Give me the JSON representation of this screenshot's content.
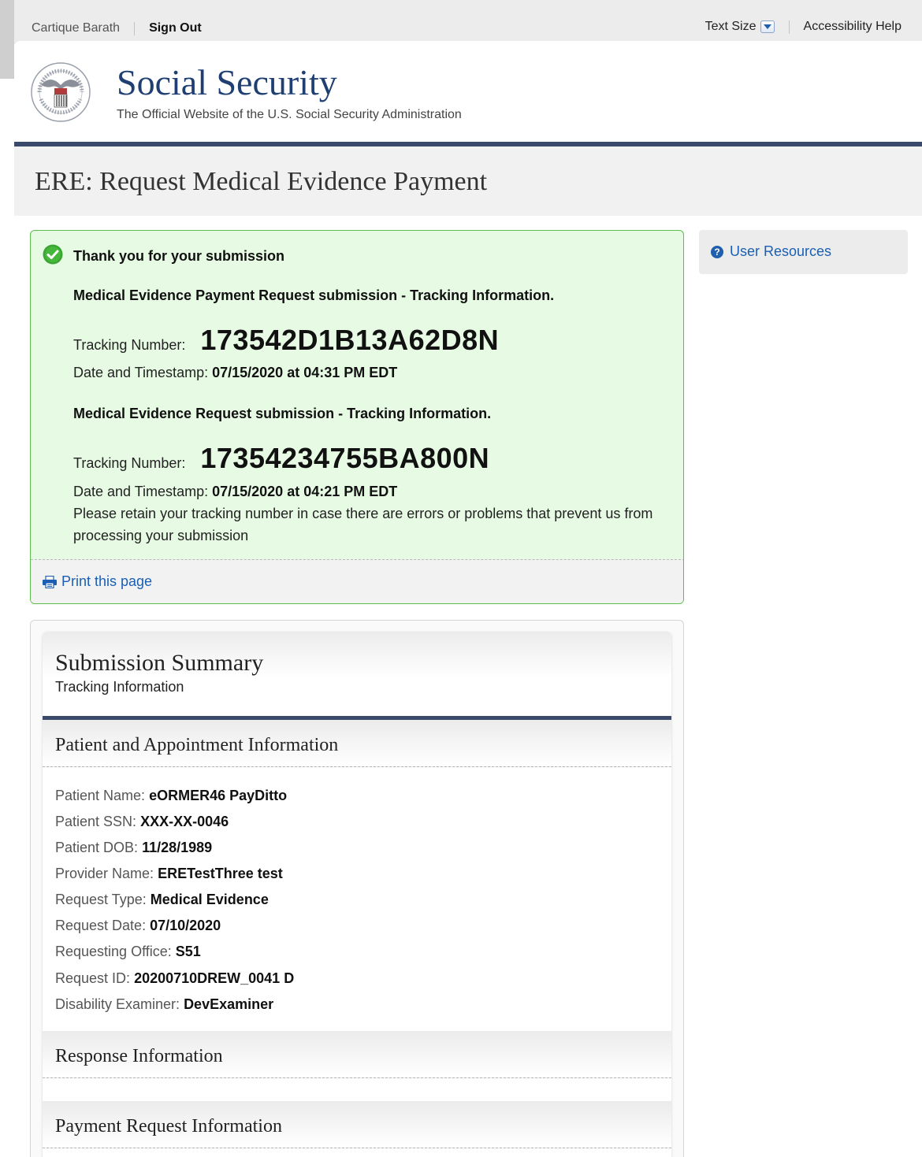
{
  "util_bar": {
    "user_name": "Cartique Barath",
    "sign_out": "Sign Out",
    "text_size": "Text Size",
    "accessibility_help": "Accessibility Help"
  },
  "header": {
    "seal_icon": "ssa-seal-icon",
    "title": "Social Security",
    "subtitle": "The Official Website of the U.S. Social Security Administration"
  },
  "page_title": "ERE: Request Medical Evidence Payment",
  "confirmation": {
    "heading": "Thank you for your submission",
    "payment_section": "Medical Evidence Payment Request submission - Tracking Information.",
    "payment_tracking_label": "Tracking Number:",
    "payment_tracking_number": "173542D1B13A62D8N",
    "payment_date_label": "Date and Timestamp:",
    "payment_date_value": "07/15/2020 at 04:31 PM EDT",
    "request_section": "Medical Evidence Request submission - Tracking Information.",
    "request_tracking_label": "Tracking Number:",
    "request_tracking_number": "17354234755BA800N",
    "request_date_label": "Date and Timestamp:",
    "request_date_value": "07/15/2020 at 04:21 PM EDT",
    "retain_note": "Please retain your tracking number in case there are errors or problems that prevent us from processing your submission",
    "print_link": "Print this page"
  },
  "sidebar": {
    "user_resources": "User Resources"
  },
  "summary": {
    "title": "Submission Summary",
    "subtitle": "Tracking Information",
    "patient_section": "Patient and Appointment Information",
    "fields": [
      {
        "label": "Patient Name:",
        "value": "eORMER46 PayDitto"
      },
      {
        "label": "Patient SSN:",
        "value": "XXX-XX-0046"
      },
      {
        "label": "Patient DOB:",
        "value": "11/28/1989"
      },
      {
        "label": "Provider Name:",
        "value": "ERETestThree test"
      },
      {
        "label": "Request Type:",
        "value": "Medical Evidence"
      },
      {
        "label": "Request Date:",
        "value": "07/10/2020"
      },
      {
        "label": "Requesting Office:",
        "value": "S51"
      },
      {
        "label": "Request ID:",
        "value": "20200710DREW_0041 D"
      },
      {
        "label": "Disability Examiner:",
        "value": "DevExaminer"
      }
    ],
    "response_section": "Response Information",
    "payment_section": "Payment Request Information"
  },
  "colors": {
    "brand_navy": "#1f3f73",
    "rule_navy": "#3b4a6b",
    "success_bg": "#e7fbe4",
    "success_border": "#5cbf4a",
    "link_blue": "#1a5fb4"
  }
}
